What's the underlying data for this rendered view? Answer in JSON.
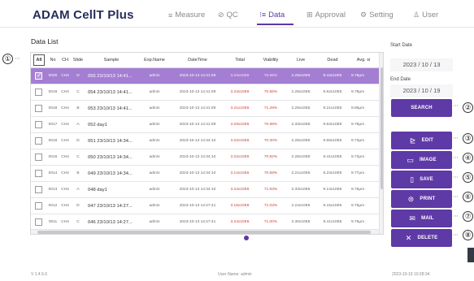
{
  "header": {
    "brand": "ADAM CellT Plus",
    "nav": [
      {
        "glyph": "≡",
        "label": "Measure"
      },
      {
        "glyph": "⊘",
        "label": "QC"
      },
      {
        "glyph": "⁝≡",
        "label": "Data"
      },
      {
        "glyph": "⊞",
        "label": "Approval"
      },
      {
        "glyph": "⚙",
        "label": "Setting"
      },
      {
        "glyph": "♙",
        "label": "User"
      }
    ],
    "active_nav": "Data"
  },
  "list": {
    "title": "Data List",
    "columns": [
      "All",
      "No",
      "CH",
      "Slide",
      "Sample",
      "Exp.Name",
      "DateTime",
      "Total",
      "Viability",
      "Live",
      "Dead",
      "Avg. si"
    ],
    "rows": [
      {
        "no": "0020",
        "ch": "CH4",
        "slide": "D",
        "sample": "055 23/10/13 14:41...",
        "exp": "admin",
        "datetime": "2023-10-13 14:41:09",
        "total": "3.24x10E6",
        "viability": "70.66%",
        "live": "2.29x10E6",
        "dead": "9.44x10E5",
        "avg": "9.76μm",
        "selected": true
      },
      {
        "no": "0019",
        "ch": "CH4",
        "slide": "C",
        "sample": "054 23/10/13 14:41...",
        "exp": "admin",
        "datetime": "2023-10-13 14:41:09",
        "total": "3.24x10E6",
        "viability": "70.66%",
        "live": "2.29x10E6",
        "dead": "9.52x10E5",
        "avg": "9.78μm",
        "selected": false
      },
      {
        "no": "0018",
        "ch": "CH4",
        "slide": "B",
        "sample": "053 23/10/13 14:41...",
        "exp": "admin",
        "datetime": "2023-10-13 14:41:09",
        "total": "3.21x10E6",
        "viability": "71.28%",
        "live": "2.29x10E6",
        "dead": "9.21x10E5",
        "avg": "9.86μm",
        "selected": false
      },
      {
        "no": "0017",
        "ch": "CH4",
        "slide": "A",
        "sample": "052 day1",
        "exp": "admin",
        "datetime": "2023-10-13 14:41:09",
        "total": "3.29x10E6",
        "viability": "70.98%",
        "live": "2.33x10E6",
        "dead": "9.53x10E5",
        "avg": "9.78μm",
        "selected": false
      },
      {
        "no": "0016",
        "ch": "CH4",
        "slide": "D",
        "sample": "051 23/10/13 14:34...",
        "exp": "admin",
        "datetime": "2023-10-13 14:34:10",
        "total": "3.22x10E6",
        "viability": "70.30%",
        "live": "2.26x10E6",
        "dead": "9.56x10E5",
        "avg": "9.73μm",
        "selected": false
      },
      {
        "no": "0015",
        "ch": "CH4",
        "slide": "C",
        "sample": "050 23/10/13 14:34...",
        "exp": "admin",
        "datetime": "2023-10-13 14:34:10",
        "total": "3.22x10E6",
        "viability": "70.82%",
        "live": "2.28x10E6",
        "dead": "9.41x10E5",
        "avg": "9.73μm",
        "selected": false
      },
      {
        "no": "0014",
        "ch": "CH4",
        "slide": "B",
        "sample": "049 23/10/13 14:34...",
        "exp": "admin",
        "datetime": "2023-10-13 14:34:10",
        "total": "3.14x10E6",
        "viability": "70.58%",
        "live": "2.21x10E6",
        "dead": "9.23x10E5",
        "avg": "9.77μm",
        "selected": false
      },
      {
        "no": "0013",
        "ch": "CH4",
        "slide": "A",
        "sample": "048 day1",
        "exp": "admin",
        "datetime": "2023-10-13 14:34:10",
        "total": "3.24x10E6",
        "viability": "71.83%",
        "live": "2.33x10E6",
        "dead": "9.14x10E5",
        "avg": "9.76μm",
        "selected": false
      },
      {
        "no": "0012",
        "ch": "CH4",
        "slide": "D",
        "sample": "047 23/10/13 14:27...",
        "exp": "admin",
        "datetime": "2023-10-13 14:27:41",
        "total": "3.15x10E6",
        "viability": "71.03%",
        "live": "2.24x10E6",
        "dead": "9.15x10E5",
        "avg": "9.75μm",
        "selected": false
      },
      {
        "no": "0011",
        "ch": "CH4",
        "slide": "C",
        "sample": "046 23/10/13 14:27...",
        "exp": "admin",
        "datetime": "2023-10-13 14:27:41",
        "total": "3.24x10E6",
        "viability": "71.00%",
        "live": "2.30x10E6",
        "dead": "9.41x10E5",
        "avg": "9.76μm",
        "selected": false
      },
      {
        "no": "0010",
        "ch": "CH4",
        "slide": "B",
        "sample": "045 23/10/13 14:27...",
        "exp": "admin",
        "datetime": "2023-10-13 14:27:41",
        "total": "3.10x10E6",
        "viability": "71.63%",
        "live": "2.21x10E6",
        "dead": "8.81x10E5",
        "avg": "9.76μm",
        "selected": false
      }
    ]
  },
  "filter": {
    "start_label": "Start Date",
    "start_value": "2023 / 10 / 13",
    "end_label": "End Date",
    "end_value": "2023 / 10 / 19",
    "search_label": "SEARCH"
  },
  "actions": [
    {
      "label": "EDIT",
      "icon": "edit-icon",
      "glyph": "⊵"
    },
    {
      "label": "IMAGE",
      "icon": "image-icon",
      "glyph": "▭"
    },
    {
      "label": "SAVE",
      "icon": "save-icon",
      "glyph": "▯"
    },
    {
      "label": "PRINT",
      "icon": "print-icon",
      "glyph": "⊜"
    },
    {
      "label": "MAIL",
      "icon": "mail-icon",
      "glyph": "✉"
    },
    {
      "label": "DELETE",
      "icon": "delete-icon",
      "glyph": "✕"
    }
  ],
  "callouts": [
    "①",
    "②",
    "③",
    "④",
    "⑤",
    "⑥",
    "⑦",
    "⑧"
  ],
  "footer": {
    "version": "V 1.4.5.6",
    "user": "User Name: admin",
    "timestamp": "2023-10-19 10:28:34"
  },
  "colors": {
    "accent": "#5e3aa6",
    "selected_row": "#a47ed3",
    "brand": "#262d5a"
  }
}
